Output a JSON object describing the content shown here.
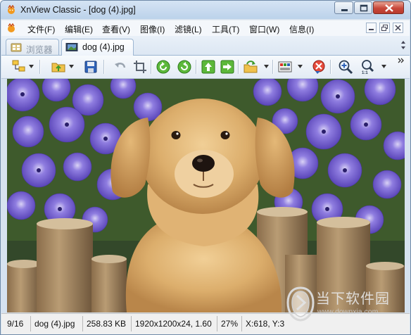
{
  "window": {
    "title": "XnView Classic - [dog (4).jpg]"
  },
  "menu": {
    "items": [
      "文件(F)",
      "编辑(E)",
      "查看(V)",
      "图像(I)",
      "滤镜(L)",
      "工具(T)",
      "窗口(W)",
      "信息(I)"
    ]
  },
  "tabs": [
    {
      "label": "浏览器",
      "active": false,
      "icon": "browser-icon"
    },
    {
      "label": "dog (4).jpg",
      "active": true,
      "icon": "filmstrip-icon"
    }
  ],
  "toolbar": {
    "buttons": [
      "browse-tree-icon",
      "open-folder-icon",
      "save-icon",
      "undo-icon",
      "crop-icon",
      "rotate-left-icon",
      "rotate-right-icon",
      "previous-icon",
      "next-icon",
      "convert-icon",
      "adjust-icon",
      "close-image-icon",
      "zoom-in-icon",
      "zoom-fit-icon"
    ]
  },
  "image": {
    "subject": "golden retriever puppy"
  },
  "status": {
    "index": "9/16",
    "filename": "dog (4).jpg",
    "filesize": "258.83 KB",
    "dimensions": "1920x1200x24, 1.60",
    "zoom": "27%",
    "cursor": "X:618, Y:3"
  },
  "watermark": {
    "brand": "当下软件园",
    "url": "www.downxia.com"
  },
  "colors": {
    "title_bar": "#c9dcf0",
    "close_button": "#c8473a",
    "accent_green": "#3f9a2c"
  }
}
